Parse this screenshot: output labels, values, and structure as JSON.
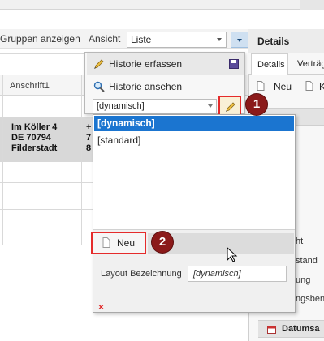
{
  "toolbar": {
    "show_groups_label": "Gruppen anzeigen",
    "view_label": "Ansicht",
    "view_value": "Liste"
  },
  "grid": {
    "column_header": "Anschrift1",
    "selected_row": {
      "address_lines": [
        "Im Köller 4",
        "DE 70794",
        "Filderstadt"
      ],
      "next_col_partial": [
        "+",
        "7",
        "8"
      ]
    }
  },
  "right_panel": {
    "title": "Details",
    "tabs": [
      {
        "label": "Details"
      },
      {
        "label": "Verträg"
      }
    ],
    "new_label": "Neu",
    "new2_label": "K",
    "section_person": "rson",
    "partial_labels": [
      "ht",
      "stand",
      "ung",
      "ngsben"
    ],
    "section_datum": "Datumsa"
  },
  "popup": {
    "menu": [
      {
        "label": "Historie erfassen"
      },
      {
        "label": "Historie ansehen"
      }
    ],
    "layout_combo_value": "[dynamisch]",
    "options": [
      {
        "label": "[dynamisch]",
        "selected": true
      },
      {
        "label": "[standard]",
        "selected": false
      }
    ],
    "new_button_label": "Neu",
    "layout_name_label": "Layout Bezeichnung",
    "layout_name_value": "[dynamisch]",
    "close_glyph": "×"
  },
  "badges": {
    "one": "1",
    "two": "2"
  },
  "colors": {
    "accent_selection": "#1b75d0",
    "highlight_red": "#e52b2b",
    "badge": "#8b1a1a"
  }
}
